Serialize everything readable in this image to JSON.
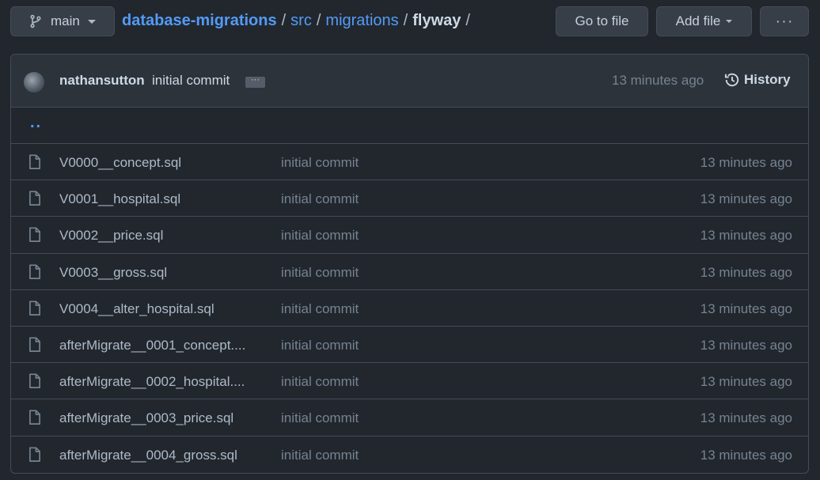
{
  "branch": {
    "icon": "git-branch-icon",
    "label": "main"
  },
  "breadcrumb": {
    "repo": "database-migrations",
    "segments": [
      "src",
      "migrations"
    ],
    "current": "flyway",
    "separator": "/"
  },
  "toolbar": {
    "go_to_file": "Go to file",
    "add_file": "Add file",
    "more": "···"
  },
  "latest_commit": {
    "author": "nathansutton",
    "message": "initial commit",
    "ellipsis": "···",
    "time": "13 minutes ago",
    "history_label": "History"
  },
  "parent_dir": "..",
  "files": [
    {
      "name": "V0000__concept.sql",
      "message": "initial commit",
      "time": "13 minutes ago"
    },
    {
      "name": "V0001__hospital.sql",
      "message": "initial commit",
      "time": "13 minutes ago"
    },
    {
      "name": "V0002__price.sql",
      "message": "initial commit",
      "time": "13 minutes ago"
    },
    {
      "name": "V0003__gross.sql",
      "message": "initial commit",
      "time": "13 minutes ago"
    },
    {
      "name": "V0004__alter_hospital.sql",
      "message": "initial commit",
      "time": "13 minutes ago"
    },
    {
      "name": "afterMigrate__0001_concept....",
      "message": "initial commit",
      "time": "13 minutes ago"
    },
    {
      "name": "afterMigrate__0002_hospital....",
      "message": "initial commit",
      "time": "13 minutes ago"
    },
    {
      "name": "afterMigrate__0003_price.sql",
      "message": "initial commit",
      "time": "13 minutes ago"
    },
    {
      "name": "afterMigrate__0004_gross.sql",
      "message": "initial commit",
      "time": "13 minutes ago"
    }
  ],
  "colors": {
    "background": "#22272e",
    "link": "#539bf5",
    "border": "#444c56",
    "header": "#2d333b"
  }
}
